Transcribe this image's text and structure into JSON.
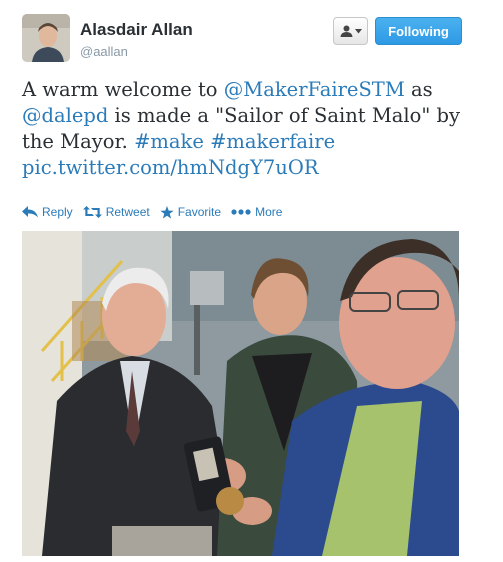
{
  "author": {
    "name": "Alasdair Allan",
    "handle": "@aallan"
  },
  "follow_button": {
    "label": "Following"
  },
  "tweet": {
    "parts": [
      {
        "text": "A warm welcome to ",
        "type": "text"
      },
      {
        "text": "@MakerFaireSTM",
        "type": "mention"
      },
      {
        "text": " as ",
        "type": "text"
      },
      {
        "text": "@dalepd",
        "type": "mention"
      },
      {
        "text": " is made a \"Sailor of Saint Malo\" by the Mayor. ",
        "type": "text"
      },
      {
        "text": "#make",
        "type": "hashtag"
      },
      {
        "text": " ",
        "type": "text"
      },
      {
        "text": "#makerfaire",
        "type": "hashtag"
      },
      {
        "text": " ",
        "type": "text"
      },
      {
        "text": "pic.twitter.com/hmNdgY7uOR",
        "type": "link"
      }
    ]
  },
  "actions": [
    {
      "label": "Reply",
      "icon": "reply-icon"
    },
    {
      "label": "Retweet",
      "icon": "retweet-icon"
    },
    {
      "label": "Favorite",
      "icon": "star-icon"
    },
    {
      "label": "More",
      "icon": "more-dots-icon"
    }
  ],
  "colors": {
    "link": "#2b7bb9",
    "follow_button": "#2e9ae4",
    "text": "#292f33",
    "muted": "#8899a6"
  }
}
